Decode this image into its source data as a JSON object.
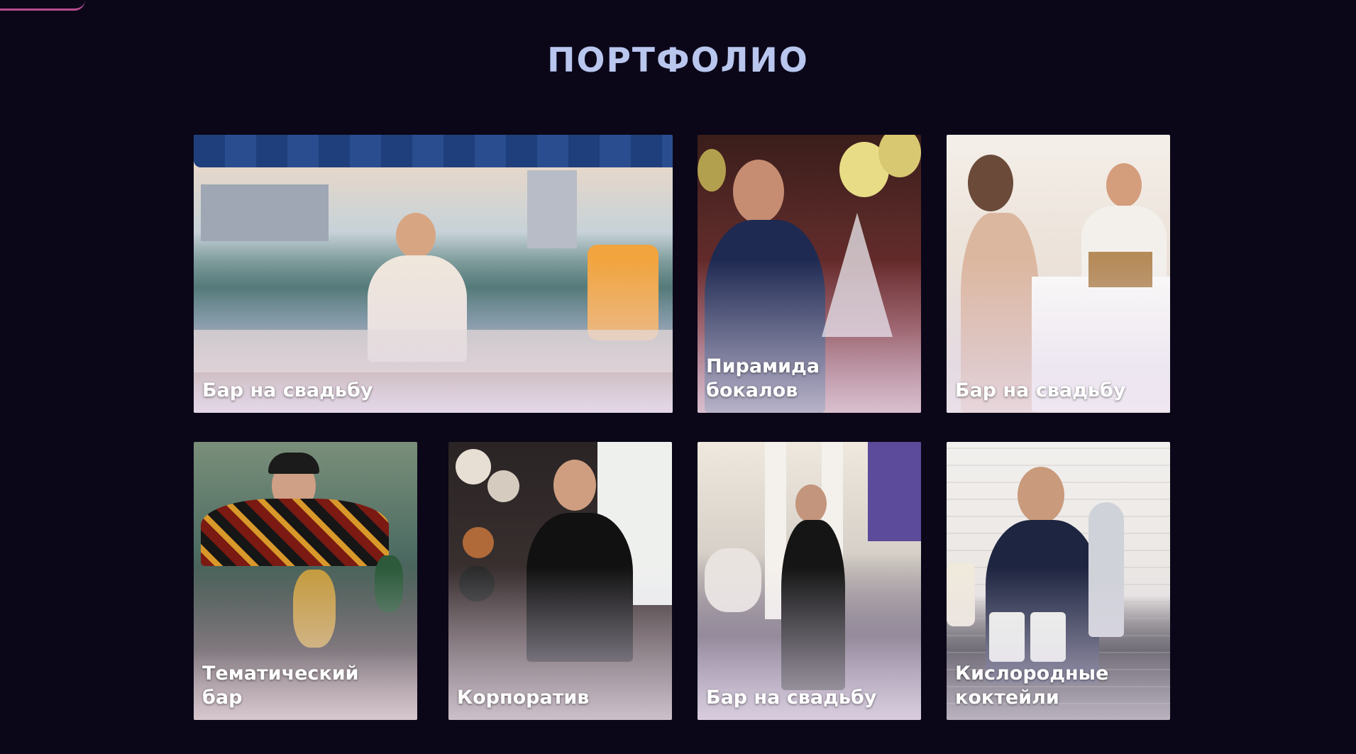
{
  "section": {
    "title": "ПОРТФОЛИО"
  },
  "cards": [
    {
      "caption": "Бар на свадьбу"
    },
    {
      "caption": "Пирамида\nбокалов"
    },
    {
      "caption": "Бар на свадьбу"
    },
    {
      "caption": "Тематический\nбар"
    },
    {
      "caption": "Корпоратив"
    },
    {
      "caption": "Бар на свадьбу"
    },
    {
      "caption": "Кислородные\nкоктейли"
    }
  ]
}
